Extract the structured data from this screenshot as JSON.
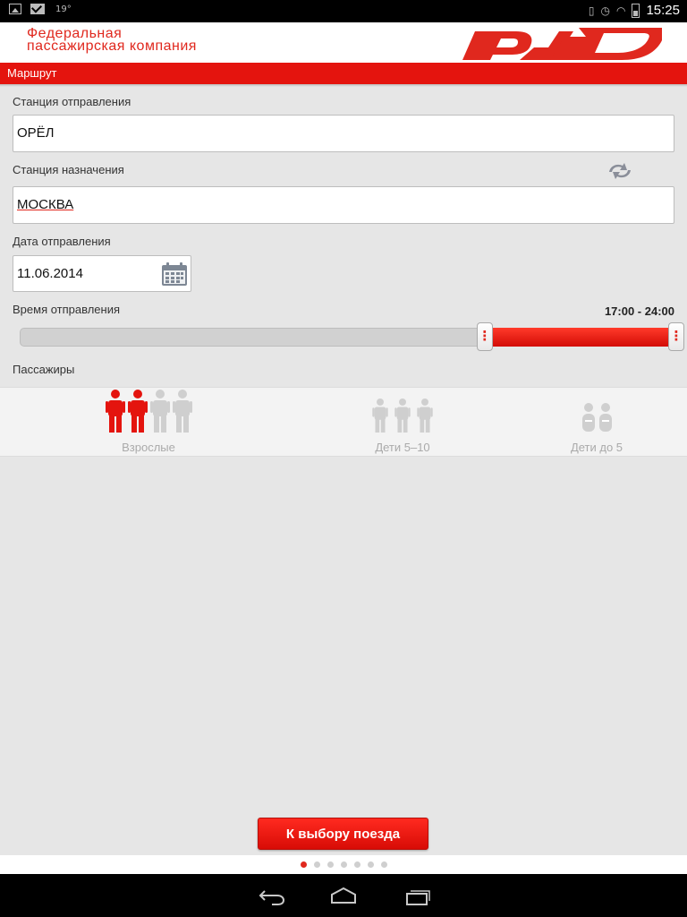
{
  "status_bar": {
    "temperature": "19°",
    "time": "15:25"
  },
  "header": {
    "company_line1": "Федеральная",
    "company_line2": "пассажирская компания",
    "logo_text": "РЖД"
  },
  "section": {
    "title": "Маршрут"
  },
  "form": {
    "departure_label": "Станция отправления",
    "departure_value": "ОРЁЛ",
    "destination_label": "Станция назначения",
    "destination_value": "МОСКВА",
    "date_label": "Дата отправления",
    "date_value": "11.06.2014",
    "time_label": "Время отправления",
    "time_range": "17:00 - 24:00",
    "time_slider": {
      "min_hour": 0,
      "max_hour": 24,
      "from_hour": 17,
      "to_hour": 24
    }
  },
  "passengers": {
    "label": "Пассажиры",
    "groups": [
      {
        "label": "Взрослые",
        "selected": 2,
        "total": 4
      },
      {
        "label": "Дети 5–10",
        "selected": 0,
        "total": 3
      },
      {
        "label": "Дети до 5",
        "selected": 0,
        "total": 2
      }
    ]
  },
  "actions": {
    "next_button": "К выбору поезда"
  },
  "pager": {
    "total": 7,
    "active": 1
  },
  "colors": {
    "accent": "#e4140e",
    "inactive_figure": "#cfcfcf",
    "background": "#e6e6e6"
  }
}
